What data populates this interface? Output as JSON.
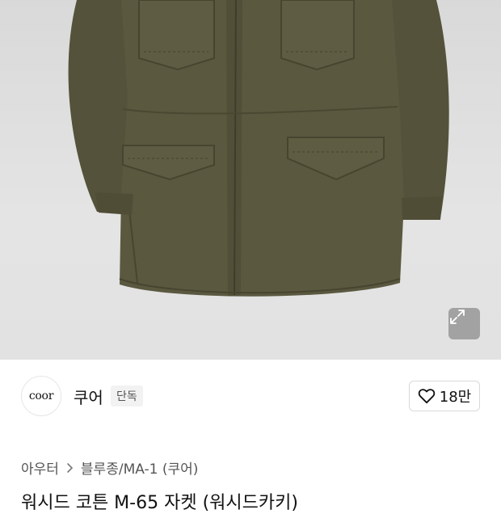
{
  "product_image": {
    "alt": "M-65 jacket in olive khaki",
    "jacket_color": "#57553c",
    "background_color": "#dddddd"
  },
  "icons": {
    "expand": "expand-arrows-icon",
    "heart": "heart-icon",
    "chevron": "chevron-right-icon"
  },
  "brand": {
    "logo_text": "coor",
    "name": "쿠어",
    "badge": "단독"
  },
  "like": {
    "count": "18만"
  },
  "breadcrumb": {
    "category": "아우터",
    "subcategory": "블루종/MA-1 (쿠어)"
  },
  "product": {
    "title": "워시드 코튼 M-65 자켓 (워시드카키)"
  }
}
